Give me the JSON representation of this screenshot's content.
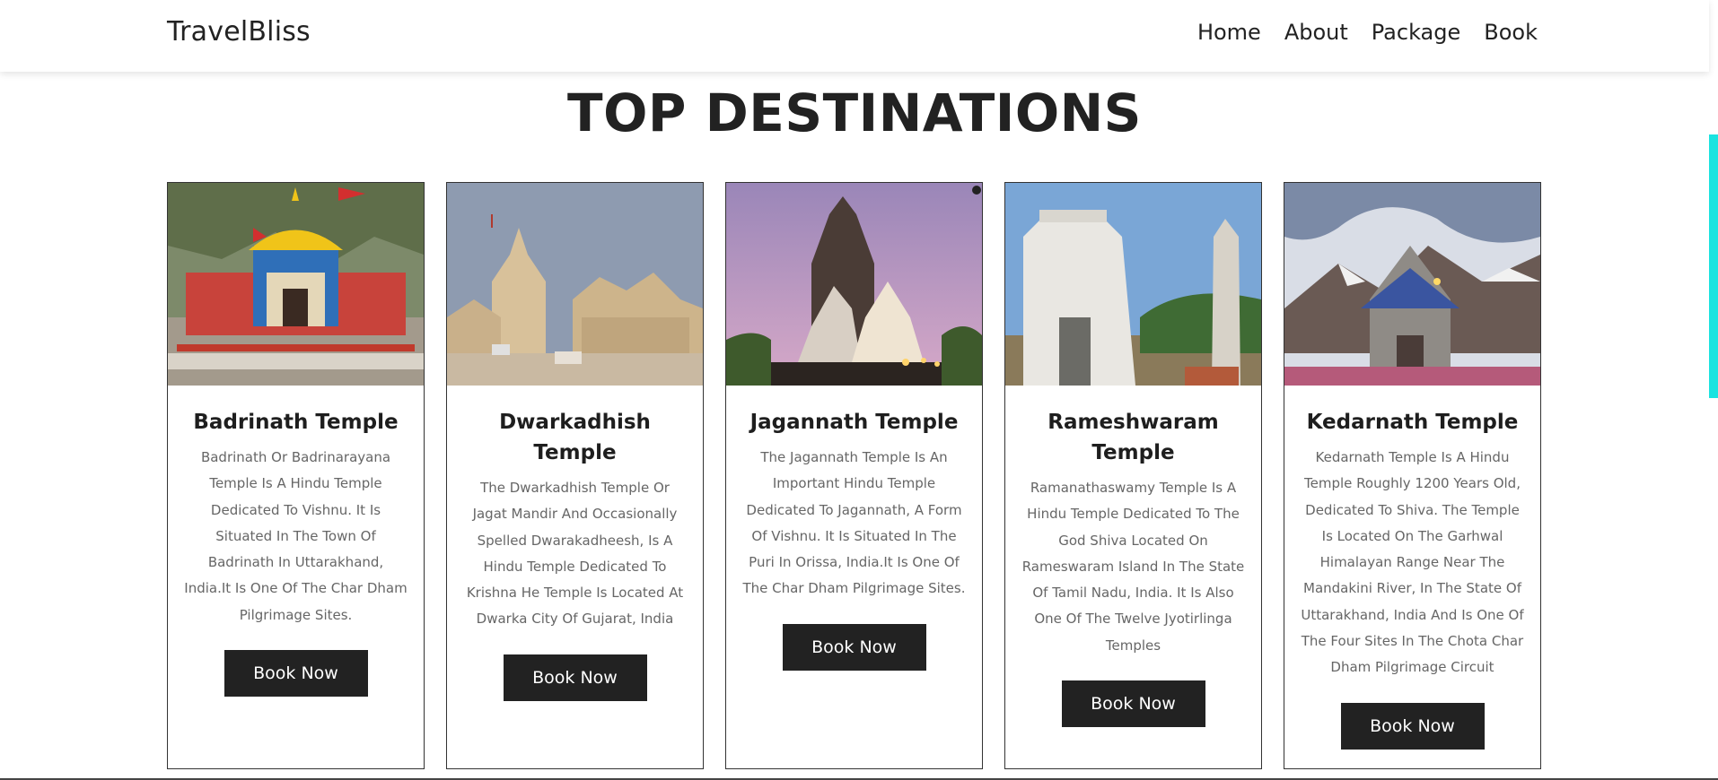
{
  "header": {
    "brand": "TravelBliss",
    "nav": [
      "Home",
      "About",
      "Package",
      "Book"
    ]
  },
  "section": {
    "title": "TOP DESTINATIONS"
  },
  "cards": [
    {
      "title": "Badrinath Temple",
      "text": "Badrinath Or Badrinarayana Temple Is A Hindu Temple Dedicated To Vishnu. It Is Situated In The Town Of Badrinath In Uttarakhand, India.It Is One Of The Char Dham Pilgrimage Sites.",
      "button": "Book Now"
    },
    {
      "title": "Dwarkadhish Temple",
      "text": "The Dwarkadhish Temple Or Jagat Mandir And Occasionally Spelled Dwarakadheesh, Is A Hindu Temple Dedicated To Krishna He Temple Is Located At Dwarka City Of Gujarat, India",
      "button": "Book Now"
    },
    {
      "title": "Jagannath Temple",
      "text": "The Jagannath Temple Is An Important Hindu Temple Dedicated To Jagannath, A Form Of Vishnu. It Is Situated In The Puri In Orissa, India.It Is One Of The Char Dham Pilgrimage Sites.",
      "button": "Book Now"
    },
    {
      "title": "Rameshwaram Temple",
      "text": "Ramanathaswamy Temple Is A Hindu Temple Dedicated To The God Shiva Located On Rameswaram Island In The State Of Tamil Nadu, India. It Is Also One Of The Twelve Jyotirlinga Temples",
      "button": "Book Now"
    },
    {
      "title": "Kedarnath Temple",
      "text": "Kedarnath Temple Is A Hindu Temple Roughly 1200 Years Old, Dedicated To Shiva. The Temple Is Located On The Garhwal Himalayan Range Near The Mandakini River, In The State Of Uttarakhand, India And Is One Of The Four Sites In The Chota Char Dham Pilgrimage Circuit",
      "button": "Book Now"
    }
  ],
  "colors": {
    "accent_scroll": "#1be3e0",
    "button_bg": "#222222",
    "text_muted": "#666666"
  }
}
